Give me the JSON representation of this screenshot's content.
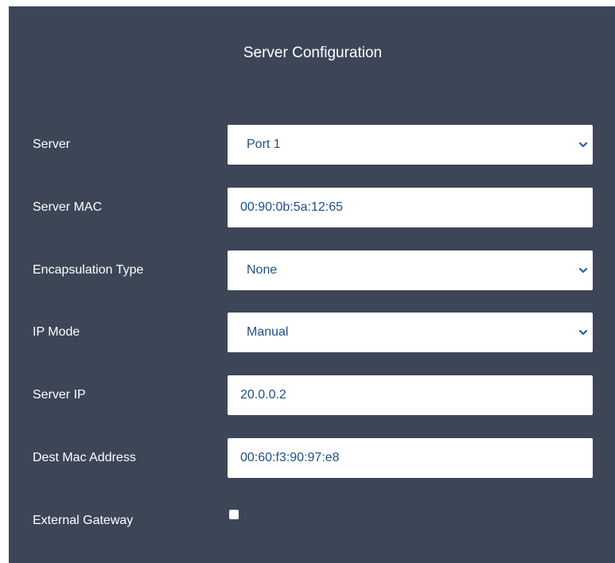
{
  "panel": {
    "title": "Server Configuration"
  },
  "form": {
    "server": {
      "label": "Server",
      "value": "Port 1"
    },
    "server_mac": {
      "label": "Server MAC",
      "value": "00:90:0b:5a:12:65"
    },
    "encapsulation_type": {
      "label": "Encapsulation Type",
      "value": "None"
    },
    "ip_mode": {
      "label": "IP Mode",
      "value": "Manual"
    },
    "server_ip": {
      "label": "Server IP",
      "value": "20.0.0.2"
    },
    "dest_mac": {
      "label": "Dest Mac Address",
      "value": "00:60:f3:90:97:e8"
    },
    "external_gateway": {
      "label": "External Gateway",
      "checked": false
    }
  },
  "icons": {
    "dropdown": "chevron-down-icon"
  },
  "colors": {
    "panel_bg": "#3c4657",
    "field_text": "#1f4e8c",
    "label_text": "#ffffff",
    "chevron": "#2d5ca8"
  }
}
